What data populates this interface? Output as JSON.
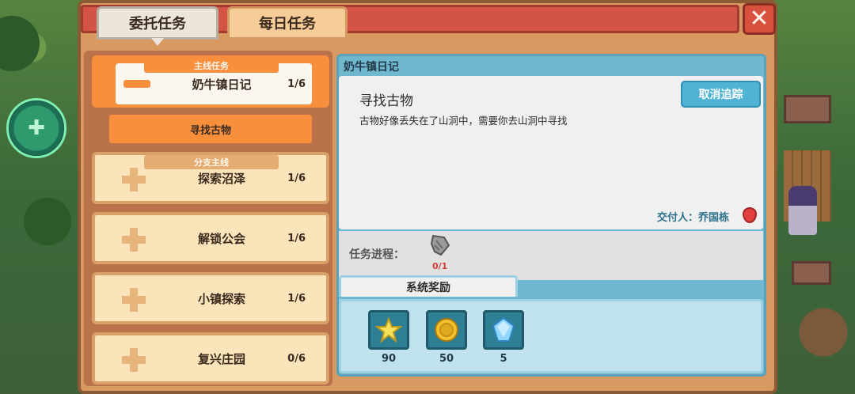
{
  "tabs": [
    {
      "label": "委托任务",
      "active": true
    },
    {
      "label": "每日任务",
      "active": false
    }
  ],
  "close_glyph": "✕",
  "categories": {
    "main": "主线任务",
    "branch": "分支主线"
  },
  "quests": {
    "main": {
      "name": "奶牛镇日记",
      "count": "1/6",
      "expanded": true
    },
    "main_sub": {
      "name": "寻找古物",
      "selected": true
    },
    "branches": [
      {
        "name": "探索沼泽",
        "count": "1/6"
      },
      {
        "name": "解锁公会",
        "count": "1/6"
      },
      {
        "name": "小镇探索",
        "count": "1/6"
      },
      {
        "name": "复兴庄园",
        "count": "0/6"
      }
    ]
  },
  "detail": {
    "header": "奶牛镇日记",
    "task_name": "寻找古物",
    "description": "古物好像丢失在了山洞中，需要你去山洞中寻找",
    "cancel_button": "取消追踪",
    "giver": "交付人：乔国栋",
    "progress_label": "任务进程：",
    "progress": {
      "current": 0,
      "target": 1,
      "text": "0/1",
      "item_icon": "stone-fragment-icon"
    }
  },
  "rewards": {
    "tab_label": "系统奖励",
    "items": [
      {
        "icon": "star-icon",
        "qty": "90"
      },
      {
        "icon": "gold-coin-icon",
        "qty": "50"
      },
      {
        "icon": "blue-gem-icon",
        "qty": "5"
      }
    ]
  },
  "colors": {
    "accent_orange": "#f78f3d",
    "header_red": "#d35445",
    "detail_blue": "#6fb8d0",
    "progress_red": "#d53b35"
  }
}
